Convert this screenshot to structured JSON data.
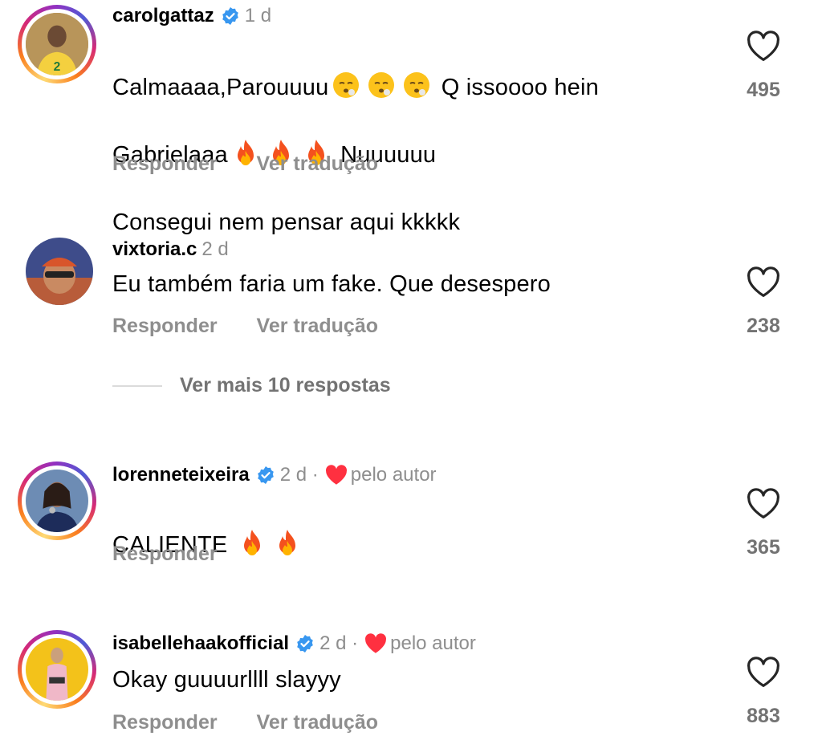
{
  "comments": [
    {
      "username": "carolgattaz",
      "verified": true,
      "time": "1 d",
      "text_line1_a": "Calmaaaa,Parouuuu",
      "text_line1_b": "Q issoooo hein",
      "text_line2_a": "Gabrielaaa",
      "text_line2_b": "Nuuuuuu",
      "text_line3": "Consegui nem pensar aqui kkkkk",
      "reply_label": "Responder",
      "translate_label": "Ver tradução",
      "likes": "495",
      "has_story_ring": true
    },
    {
      "username": "vixtoria.c",
      "verified": false,
      "time": "2 d",
      "text": "Eu também faria um fake. Que desespero",
      "reply_label": "Responder",
      "translate_label": "Ver tradução",
      "likes": "238",
      "has_story_ring": false
    },
    {
      "username": "lorenneteixeira",
      "verified": true,
      "time": "2 d ·",
      "liked_by_author": "pelo autor",
      "text": "CALIENTE",
      "reply_label": "Responder",
      "likes": "365",
      "has_story_ring": true
    },
    {
      "username": "isabellehaakofficial",
      "verified": true,
      "time": "2 d ·",
      "liked_by_author": "pelo autor",
      "text": "Okay guuuurllll slayyy",
      "reply_label": "Responder",
      "translate_label": "Ver tradução",
      "likes": "883",
      "has_story_ring": true
    }
  ],
  "view_more_replies": "Ver mais 10 respostas",
  "colors": {
    "verified": "#3897f0",
    "heart_red": "#ff3040",
    "meta_gray": "#8e8e8e"
  }
}
